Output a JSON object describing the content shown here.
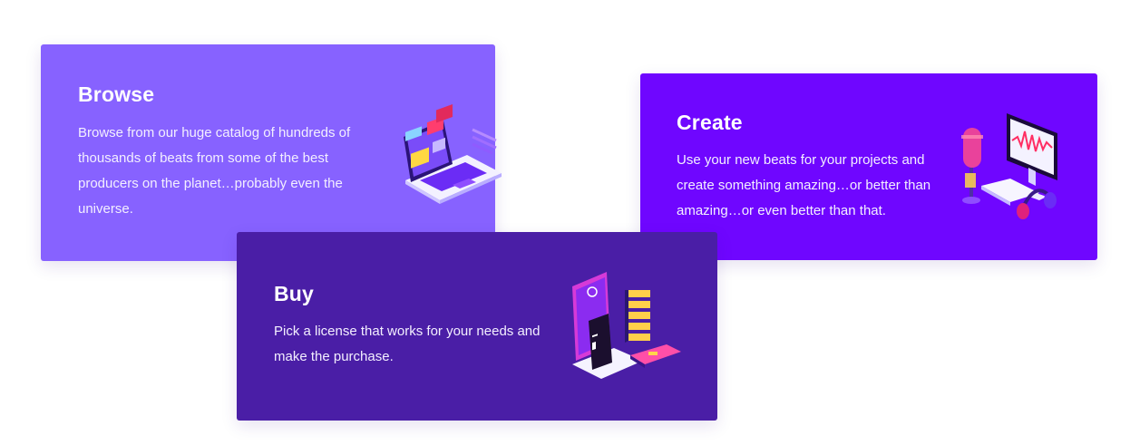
{
  "cards": {
    "browse": {
      "title": "Browse",
      "text": "Browse from our huge catalog of hundreds of thousands of beats from some of the best producers on the planet…probably even the universe.",
      "illustration": "laptop-charts-icon",
      "color": "#8762ff"
    },
    "create": {
      "title": "Create",
      "text": "Use your new beats for your projects and create something amazing…or better than amazing…or even better than that.",
      "illustration": "studio-microphone-monitor-icon",
      "color": "#6f06ff"
    },
    "buy": {
      "title": "Buy",
      "text": "Pick a license that works for your needs and make the purchase.",
      "illustration": "phone-receipt-credit-card-icon",
      "color": "#4a1ea6"
    }
  }
}
